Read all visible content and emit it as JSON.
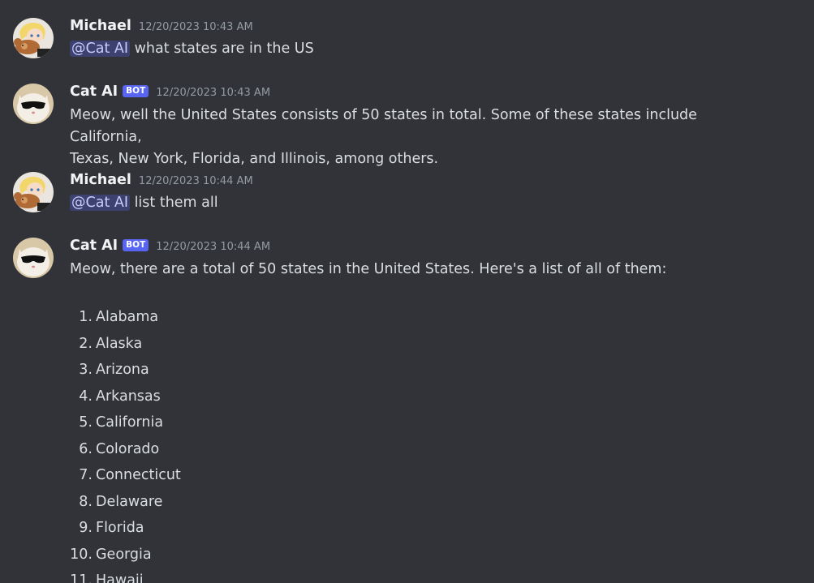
{
  "messages": [
    {
      "author": "Michael",
      "timestamp": "12/20/2023 10:43 AM",
      "mention": "@Cat AI",
      "text": " what states are in the US"
    },
    {
      "author": "Cat AI",
      "bot_tag": "BOT",
      "timestamp": "12/20/2023 10:43 AM",
      "line1": "Meow, well the United States consists of 50 states in total. Some of these states include California,",
      "line2": "Texas, New York, Florida, and Illinois, among others."
    },
    {
      "author": "Michael",
      "timestamp": "12/20/2023 10:44 AM",
      "mention": "@Cat AI",
      "text": " list them all"
    },
    {
      "author": "Cat AI",
      "bot_tag": "BOT",
      "timestamp": "12/20/2023 10:44 AM",
      "intro": "Meow, there are a total of 50 states in the United States. Here's a list of all of them:",
      "list": [
        {
          "num": "1.",
          "name": "Alabama"
        },
        {
          "num": "2.",
          "name": "Alaska"
        },
        {
          "num": "3.",
          "name": "Arizona"
        },
        {
          "num": "4.",
          "name": "Arkansas"
        },
        {
          "num": "5.",
          "name": "California"
        },
        {
          "num": "6.",
          "name": "Colorado"
        },
        {
          "num": "7.",
          "name": "Connecticut"
        },
        {
          "num": "8.",
          "name": "Delaware"
        },
        {
          "num": "9.",
          "name": "Florida"
        },
        {
          "num": "10.",
          "name": "Georgia"
        },
        {
          "num": "11.",
          "name": "Hawaii"
        }
      ]
    }
  ],
  "colors": {
    "background": "#313338",
    "username": "#f2f3f5",
    "text": "#dbdee1",
    "timestamp": "#949ba4",
    "bot_tag": "#5865f2",
    "mention_bg": "#3c4270",
    "mention_text": "#c9cdfb"
  },
  "icons": {
    "michael_avatar": "anime-character-with-teddy-bear-avatar",
    "cat_avatar": "cat-with-sunglasses-avatar"
  }
}
